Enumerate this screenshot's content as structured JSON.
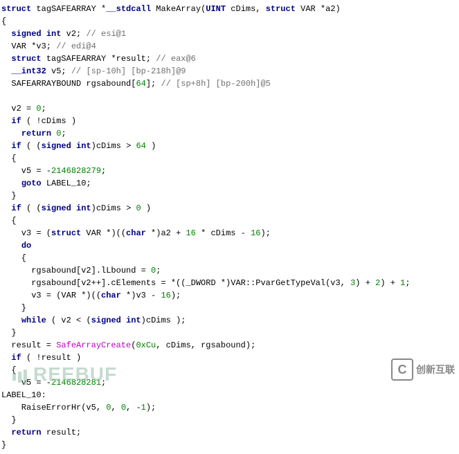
{
  "code": {
    "lines": [
      {
        "segs": [
          {
            "c": "kw",
            "t": "struct"
          },
          {
            "c": "txt",
            "t": " tagSAFEARRAY *"
          },
          {
            "c": "kw",
            "t": "__stdcall"
          },
          {
            "c": "txt",
            "t": " MakeArray("
          },
          {
            "c": "kw",
            "t": "UINT"
          },
          {
            "c": "txt",
            "t": " cDims, "
          },
          {
            "c": "kw",
            "t": "struct"
          },
          {
            "c": "txt",
            "t": " VAR *a2)"
          }
        ]
      },
      {
        "segs": [
          {
            "c": "txt",
            "t": "{"
          }
        ]
      },
      {
        "segs": [
          {
            "c": "txt",
            "t": "  "
          },
          {
            "c": "kw",
            "t": "signed"
          },
          {
            "c": "txt",
            "t": " "
          },
          {
            "c": "kw",
            "t": "int"
          },
          {
            "c": "txt",
            "t": " v2; "
          },
          {
            "c": "cmt",
            "t": "// esi@1"
          }
        ]
      },
      {
        "segs": [
          {
            "c": "txt",
            "t": "  VAR *v3; "
          },
          {
            "c": "cmt",
            "t": "// edi@4"
          }
        ]
      },
      {
        "segs": [
          {
            "c": "txt",
            "t": "  "
          },
          {
            "c": "kw",
            "t": "struct"
          },
          {
            "c": "txt",
            "t": " tagSAFEARRAY *result; "
          },
          {
            "c": "cmt",
            "t": "// eax@6"
          }
        ]
      },
      {
        "segs": [
          {
            "c": "txt",
            "t": "  "
          },
          {
            "c": "kw",
            "t": "__int32"
          },
          {
            "c": "txt",
            "t": " v5; "
          },
          {
            "c": "cmt",
            "t": "// [sp-10h] [bp-218h]@9"
          }
        ]
      },
      {
        "segs": [
          {
            "c": "txt",
            "t": "  SAFEARRAYBOUND rgsabound["
          },
          {
            "c": "num",
            "t": "64"
          },
          {
            "c": "txt",
            "t": "]; "
          },
          {
            "c": "cmt",
            "t": "// [sp+8h] [bp-200h]@5"
          }
        ]
      },
      {
        "segs": [
          {
            "c": "txt",
            "t": ""
          }
        ]
      },
      {
        "segs": [
          {
            "c": "txt",
            "t": "  v2 = "
          },
          {
            "c": "num",
            "t": "0"
          },
          {
            "c": "txt",
            "t": ";"
          }
        ]
      },
      {
        "segs": [
          {
            "c": "txt",
            "t": "  "
          },
          {
            "c": "kw",
            "t": "if"
          },
          {
            "c": "txt",
            "t": " ( !cDims )"
          }
        ]
      },
      {
        "segs": [
          {
            "c": "txt",
            "t": "    "
          },
          {
            "c": "kw",
            "t": "return"
          },
          {
            "c": "txt",
            "t": " "
          },
          {
            "c": "num",
            "t": "0"
          },
          {
            "c": "txt",
            "t": ";"
          }
        ]
      },
      {
        "segs": [
          {
            "c": "txt",
            "t": "  "
          },
          {
            "c": "kw",
            "t": "if"
          },
          {
            "c": "txt",
            "t": " ( ("
          },
          {
            "c": "kw",
            "t": "signed"
          },
          {
            "c": "txt",
            "t": " "
          },
          {
            "c": "kw",
            "t": "int"
          },
          {
            "c": "txt",
            "t": ")cDims > "
          },
          {
            "c": "num",
            "t": "64"
          },
          {
            "c": "txt",
            "t": " )"
          }
        ]
      },
      {
        "segs": [
          {
            "c": "txt",
            "t": "  {"
          }
        ]
      },
      {
        "segs": [
          {
            "c": "txt",
            "t": "    v5 = -"
          },
          {
            "c": "num",
            "t": "2146828279"
          },
          {
            "c": "txt",
            "t": ";"
          }
        ]
      },
      {
        "segs": [
          {
            "c": "txt",
            "t": "    "
          },
          {
            "c": "kw",
            "t": "goto"
          },
          {
            "c": "txt",
            "t": " LABEL_10;"
          }
        ]
      },
      {
        "segs": [
          {
            "c": "txt",
            "t": "  }"
          }
        ]
      },
      {
        "segs": [
          {
            "c": "txt",
            "t": "  "
          },
          {
            "c": "kw",
            "t": "if"
          },
          {
            "c": "txt",
            "t": " ( ("
          },
          {
            "c": "kw",
            "t": "signed"
          },
          {
            "c": "txt",
            "t": " "
          },
          {
            "c": "kw",
            "t": "int"
          },
          {
            "c": "txt",
            "t": ")cDims > "
          },
          {
            "c": "num",
            "t": "0"
          },
          {
            "c": "txt",
            "t": " )"
          }
        ]
      },
      {
        "segs": [
          {
            "c": "txt",
            "t": "  {"
          }
        ]
      },
      {
        "segs": [
          {
            "c": "txt",
            "t": "    v3 = ("
          },
          {
            "c": "kw",
            "t": "struct"
          },
          {
            "c": "txt",
            "t": " VAR *)(("
          },
          {
            "c": "kw",
            "t": "char"
          },
          {
            "c": "txt",
            "t": " *)a2 + "
          },
          {
            "c": "num",
            "t": "16"
          },
          {
            "c": "txt",
            "t": " * cDims - "
          },
          {
            "c": "num",
            "t": "16"
          },
          {
            "c": "txt",
            "t": ");"
          }
        ]
      },
      {
        "segs": [
          {
            "c": "txt",
            "t": "    "
          },
          {
            "c": "kw",
            "t": "do"
          }
        ]
      },
      {
        "segs": [
          {
            "c": "txt",
            "t": "    {"
          }
        ]
      },
      {
        "segs": [
          {
            "c": "txt",
            "t": "      rgsabound[v2].lLbound = "
          },
          {
            "c": "num",
            "t": "0"
          },
          {
            "c": "txt",
            "t": ";"
          }
        ]
      },
      {
        "segs": [
          {
            "c": "txt",
            "t": "      rgsabound[v2++].cElements = *((_DWORD *)VAR::PvarGetTypeVal(v3, "
          },
          {
            "c": "num",
            "t": "3"
          },
          {
            "c": "txt",
            "t": ") + "
          },
          {
            "c": "num",
            "t": "2"
          },
          {
            "c": "txt",
            "t": ") + "
          },
          {
            "c": "num",
            "t": "1"
          },
          {
            "c": "txt",
            "t": ";"
          }
        ]
      },
      {
        "segs": [
          {
            "c": "txt",
            "t": "      v3 = (VAR *)(("
          },
          {
            "c": "kw",
            "t": "char"
          },
          {
            "c": "txt",
            "t": " *)v3 - "
          },
          {
            "c": "num",
            "t": "16"
          },
          {
            "c": "txt",
            "t": ");"
          }
        ]
      },
      {
        "segs": [
          {
            "c": "txt",
            "t": "    }"
          }
        ]
      },
      {
        "segs": [
          {
            "c": "txt",
            "t": "    "
          },
          {
            "c": "kw",
            "t": "while"
          },
          {
            "c": "txt",
            "t": " ( v2 < ("
          },
          {
            "c": "kw",
            "t": "signed"
          },
          {
            "c": "txt",
            "t": " "
          },
          {
            "c": "kw",
            "t": "int"
          },
          {
            "c": "txt",
            "t": ")cDims );"
          }
        ]
      },
      {
        "segs": [
          {
            "c": "txt",
            "t": "  }"
          }
        ]
      },
      {
        "segs": [
          {
            "c": "txt",
            "t": "  result = "
          },
          {
            "c": "fn",
            "t": "SafeArrayCreate"
          },
          {
            "c": "txt",
            "t": "("
          },
          {
            "c": "num",
            "t": "0xCu"
          },
          {
            "c": "txt",
            "t": ", cDims, rgsabound);"
          }
        ]
      },
      {
        "segs": [
          {
            "c": "txt",
            "t": "  "
          },
          {
            "c": "kw",
            "t": "if"
          },
          {
            "c": "txt",
            "t": " ( !result )"
          }
        ]
      },
      {
        "segs": [
          {
            "c": "txt",
            "t": "  {"
          }
        ]
      },
      {
        "segs": [
          {
            "c": "txt",
            "t": "    v5 = -"
          },
          {
            "c": "num",
            "t": "2146828281"
          },
          {
            "c": "txt",
            "t": ";"
          }
        ]
      },
      {
        "segs": [
          {
            "c": "txt",
            "t": "LABEL_10:"
          }
        ]
      },
      {
        "segs": [
          {
            "c": "txt",
            "t": "    RaiseErrorHr(v5, "
          },
          {
            "c": "num",
            "t": "0"
          },
          {
            "c": "txt",
            "t": ", "
          },
          {
            "c": "num",
            "t": "0"
          },
          {
            "c": "txt",
            "t": ", -"
          },
          {
            "c": "num",
            "t": "1"
          },
          {
            "c": "txt",
            "t": ");"
          }
        ]
      },
      {
        "segs": [
          {
            "c": "txt",
            "t": "  }"
          }
        ]
      },
      {
        "segs": [
          {
            "c": "txt",
            "t": "  "
          },
          {
            "c": "kw",
            "t": "return"
          },
          {
            "c": "txt",
            "t": " result;"
          }
        ]
      },
      {
        "segs": [
          {
            "c": "txt",
            "t": "}"
          }
        ]
      }
    ]
  },
  "watermarks": {
    "left": "REEBUF",
    "right_badge": "C",
    "right_text": "创新互联"
  }
}
